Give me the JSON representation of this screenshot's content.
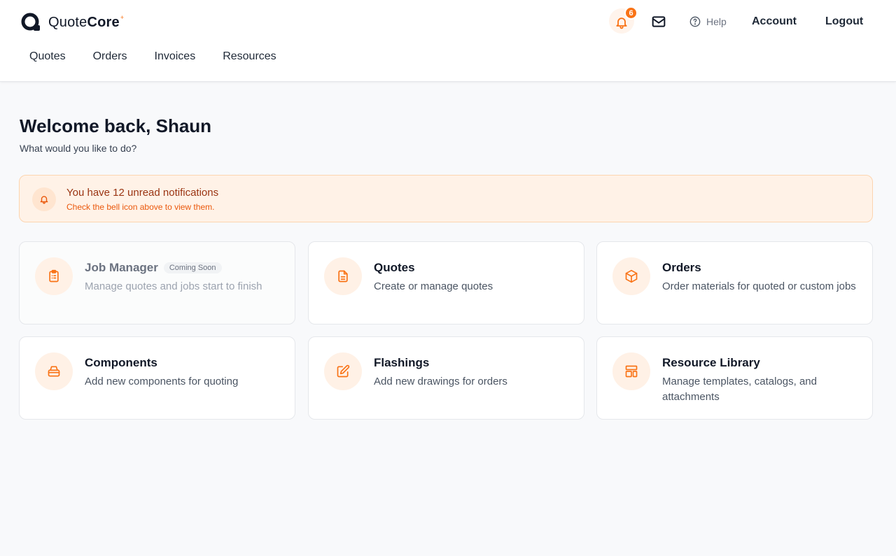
{
  "header": {
    "logo": {
      "light": "Quote",
      "bold": "Core",
      "mark": "+"
    },
    "nav": [
      "Quotes",
      "Orders",
      "Invoices",
      "Resources"
    ],
    "notifications_badge": "6",
    "help_label": "Help",
    "account_label": "Account",
    "logout_label": "Logout"
  },
  "main": {
    "welcome": "Welcome back, Shaun",
    "subtitle": "What would you like to do?"
  },
  "notice": {
    "title": "You have 12 unread notifications",
    "subtitle": "Check the bell icon above to view them."
  },
  "cards": [
    {
      "title": "Job Manager",
      "badge": "Coming Soon",
      "desc": "Manage quotes and jobs start to finish",
      "icon": "clipboard-icon"
    },
    {
      "title": "Quotes",
      "desc": "Create or manage quotes",
      "icon": "document-icon"
    },
    {
      "title": "Orders",
      "desc": "Order materials for quoted or custom jobs",
      "icon": "box-icon"
    },
    {
      "title": "Components",
      "desc": "Add new components for quoting",
      "icon": "layers-icon"
    },
    {
      "title": "Flashings",
      "desc": "Add new drawings for orders",
      "icon": "edit-icon"
    },
    {
      "title": "Resource Library",
      "desc": "Manage templates, catalogs, and attachments",
      "icon": "layout-icon"
    }
  ],
  "colors": {
    "accent": "#f97316",
    "notice_bg": "#fff2e7",
    "text": "#111827"
  }
}
